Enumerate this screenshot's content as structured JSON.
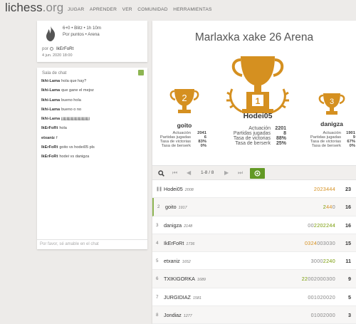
{
  "header": {
    "logo": "lichess",
    "logo_tld": ".org",
    "nav": [
      "JUGAR",
      "APRENDER",
      "VER",
      "COMUNIDAD",
      "HERRAMIENTAS"
    ]
  },
  "info": {
    "line1": "6+0 • Blitz • 1h 10m",
    "line2": "Por puntos • Arena",
    "by_label": "por",
    "creator": "IkErFoRt",
    "date": "4 jun. 2020 18:00"
  },
  "chat": {
    "title": "Sala de chat",
    "placeholder": "Por favor, sé amable en el chat",
    "messages": [
      {
        "user": "Ikhi-Lama",
        "text": "hola que hay?"
      },
      {
        "user": "Ikhi-Lama",
        "text": "que gane el mejoz"
      },
      {
        "user": "Ikhi-Lama",
        "text": "bueno hola"
      },
      {
        "user": "Ikhi-Lama",
        "text": "bueno o no"
      },
      {
        "user": "Ikhi-Lama",
        "text": "jjjjjjjjjjjjjjjjjjjjjjjjjjjjjjjj"
      },
      {
        "user": "IkErFoRt",
        "text": "hola"
      },
      {
        "user": "etxaniz",
        "text": "f"
      },
      {
        "user": "IkErFoRt",
        "text": "goito vs hodei05 pls"
      },
      {
        "user": "IkErFoRt",
        "text": "hodei vs danigza"
      }
    ]
  },
  "main": {
    "title": "Marlaxka xake 26 Arena",
    "podium": {
      "first": {
        "rank": "1",
        "name": "Hodei05",
        "stats": [
          [
            "Actuación",
            "2201"
          ],
          [
            "Partidas jugadas",
            "8"
          ],
          [
            "Tasa de victorias",
            "88%"
          ],
          [
            "Tasa de berserk",
            "25%"
          ]
        ]
      },
      "second": {
        "rank": "2",
        "name": "goito",
        "stats": [
          [
            "Actuación",
            "2041"
          ],
          [
            "Partidas jugadas",
            "6"
          ],
          [
            "Tasa de victorias",
            "83%"
          ],
          [
            "Tasa de berserk",
            "0%"
          ]
        ]
      },
      "third": {
        "rank": "3",
        "name": "danigza",
        "stats": [
          [
            "Actuación",
            "1901"
          ],
          [
            "Partidas jugadas",
            "9"
          ],
          [
            "Tasa de victorias",
            "67%"
          ],
          [
            "Tasa de berserk",
            "0%"
          ]
        ]
      }
    },
    "pager": {
      "count": "1-8 / 8"
    },
    "standings": [
      {
        "rank": "",
        "paused": true,
        "name": "Hodei05",
        "rating": "2008",
        "sheet": [
          [
            "4",
            "2023"
          ],
          [
            "4",
            "444"
          ]
        ],
        "total": "23"
      },
      {
        "rank": "2",
        "name": "goito",
        "rating": "1917",
        "sheet": [
          [
            "2",
            "2"
          ],
          [
            "4",
            "44"
          ],
          [
            "l",
            "0"
          ]
        ],
        "total": "16"
      },
      {
        "rank": "3",
        "name": "danigza",
        "rating": "2148",
        "sheet": [
          [
            "l",
            "00"
          ],
          [
            "2",
            "2202244"
          ]
        ],
        "total": "16"
      },
      {
        "rank": "4",
        "name": "IkErFoRt",
        "rating": "1736",
        "sheet": [
          [
            "4",
            "0324"
          ],
          [
            "l",
            "003030"
          ]
        ],
        "total": "15"
      },
      {
        "rank": "5",
        "name": "etxaniz",
        "rating": "1652",
        "sheet": [
          [
            "l",
            "3000"
          ],
          [
            "2",
            "2240"
          ]
        ],
        "total": "11"
      },
      {
        "rank": "6",
        "name": "TXIKIGORKA",
        "rating": "1689",
        "sheet": [
          [
            "2",
            "22"
          ],
          [
            "l",
            "002000300"
          ]
        ],
        "total": "9"
      },
      {
        "rank": "7",
        "name": "JURGIDIAZ",
        "rating": "1581",
        "sheet": [
          [
            "l",
            "001020020"
          ]
        ],
        "total": "5"
      },
      {
        "rank": "8",
        "name": "Jondiaz",
        "rating": "1277",
        "sheet": [
          [
            "l",
            "01002000"
          ]
        ],
        "total": "3"
      }
    ]
  },
  "colors": {
    "gold": "#d59020",
    "green": "#629924",
    "streak_green": "#759900"
  }
}
